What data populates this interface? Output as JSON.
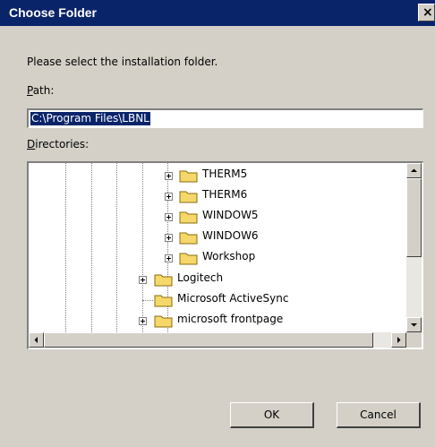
{
  "dialog": {
    "title": "Choose Folder",
    "close_glyph": "✕",
    "prompt": "Please select the installation folder.",
    "path_label": "Path:",
    "path_value": "C:\\Program Files\\LBNL",
    "directories_label": "Directories:",
    "ok_label": "OK",
    "cancel_label": "Cancel"
  },
  "tree": {
    "items": [
      {
        "label": "THERM5",
        "expandable": true
      },
      {
        "label": "THERM6",
        "expandable": true
      },
      {
        "label": "WINDOW5",
        "expandable": true
      },
      {
        "label": "WINDOW6",
        "expandable": true
      },
      {
        "label": "Workshop",
        "expandable": true
      },
      {
        "label": "Logitech",
        "expandable": true
      },
      {
        "label": "Microsoft ActiveSync",
        "expandable": false
      },
      {
        "label": "microsoft frontpage",
        "expandable": true
      }
    ]
  },
  "colors": {
    "titlebar": "#0a246a",
    "selection": "#0a246a",
    "face": "#d4d0c8",
    "folder": "#f6d769"
  }
}
